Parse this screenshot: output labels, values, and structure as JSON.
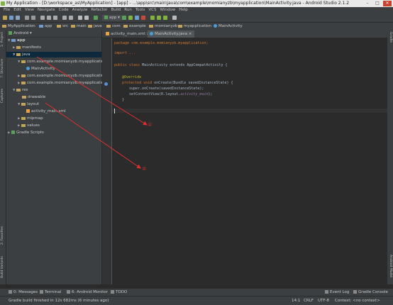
{
  "window": {
    "title": "My Application - [D:\\workspace_as\\MyApplication] - [app] - ...\\app\\src\\main\\java\\com\\example\\momianyzb\\myapplication\\MainActivity.java - Android Studio 2.1.2",
    "controls": [
      "–",
      "□",
      "✕"
    ]
  },
  "menu": [
    "File",
    "Edit",
    "View",
    "Navigate",
    "Code",
    "Analyze",
    "Refactor",
    "Build",
    "Run",
    "Tools",
    "VCS",
    "Window",
    "Help"
  ],
  "toolbar": {
    "run_config": "app"
  },
  "breadcrumbs": [
    "MyApplication",
    "app",
    "src",
    "main",
    "java",
    "com",
    "example",
    "momianyzb",
    "myapplication",
    "MainActivity"
  ],
  "project_panel": {
    "view_mode": "Android",
    "tree": [
      {
        "label": "app",
        "depth": 0,
        "expanded": true,
        "kind": "folder-blue",
        "bold": true
      },
      {
        "label": "manifests",
        "depth": 1,
        "expanded": false,
        "kind": "folder"
      },
      {
        "label": "java",
        "depth": 1,
        "expanded": true,
        "kind": "folder",
        "selected": true
      },
      {
        "label": "com.example.momianyzb.myapplication",
        "depth": 2,
        "expanded": true,
        "kind": "folder"
      },
      {
        "label": "MainActivity",
        "depth": 3,
        "kind": "class"
      },
      {
        "label": "com.example.momianyzb.myapplication",
        "depth": 2,
        "expanded": false,
        "kind": "folder"
      },
      {
        "label": "com.example.momianyzb.myapplication",
        "depth": 2,
        "expanded": false,
        "kind": "folder"
      },
      {
        "label": "res",
        "depth": 1,
        "expanded": true,
        "kind": "folder"
      },
      {
        "label": "drawable",
        "depth": 2,
        "kind": "folder"
      },
      {
        "label": "layout",
        "depth": 2,
        "expanded": true,
        "kind": "folder"
      },
      {
        "label": "activity_main.xml",
        "depth": 3,
        "kind": "xml"
      },
      {
        "label": "mipmap",
        "depth": 2,
        "expanded": false,
        "kind": "folder"
      },
      {
        "label": "values",
        "depth": 2,
        "expanded": false,
        "kind": "folder"
      },
      {
        "label": "Gradle Scripts",
        "depth": 0,
        "expanded": false,
        "kind": "gradle"
      }
    ]
  },
  "editor_tabs": [
    {
      "label": "activity_main.xml",
      "active": false
    },
    {
      "label": "MainActivity.java",
      "active": true
    }
  ],
  "code": {
    "l1": [
      "package com.example.momianyzb.myapplication;"
    ],
    "l2": [
      "import ..."
    ],
    "l3_kw": "public class ",
    "l3_rest": "MainActivity extends AppCompatActivity {",
    "l4": "@Override",
    "l5_kw": "protected void ",
    "l5_rest": "onCreate(Bundle savedInstanceState) {",
    "l6": "super.onCreate(savedInstanceState);",
    "l7_a": "setContentView(R.layout.",
    "l7_fld": "activity_main",
    "l7_b": ");",
    "l8": "}"
  },
  "left_tool_tabs": [
    "1: Project",
    "7: Structure",
    "Captures",
    "2: Favorites",
    "Build Variants"
  ],
  "right_tool_tabs": [
    "Gradle",
    "Android Model"
  ],
  "bottom_tabs": [
    "0: Messages",
    "Terminal",
    "6: Android Monitor",
    "TODO"
  ],
  "bottom_right_tabs": [
    "Event Log",
    "Gradle Console"
  ],
  "status": {
    "message": "Gradle build finished in 12s 682ms (6 minutes ago)",
    "position": "14:1",
    "line_sep": "CRLF",
    "encoding": "UTF-8",
    "context": "Context: <no context>"
  },
  "annotations": {
    "one": "①",
    "two": "②",
    "color": "#e03030"
  }
}
